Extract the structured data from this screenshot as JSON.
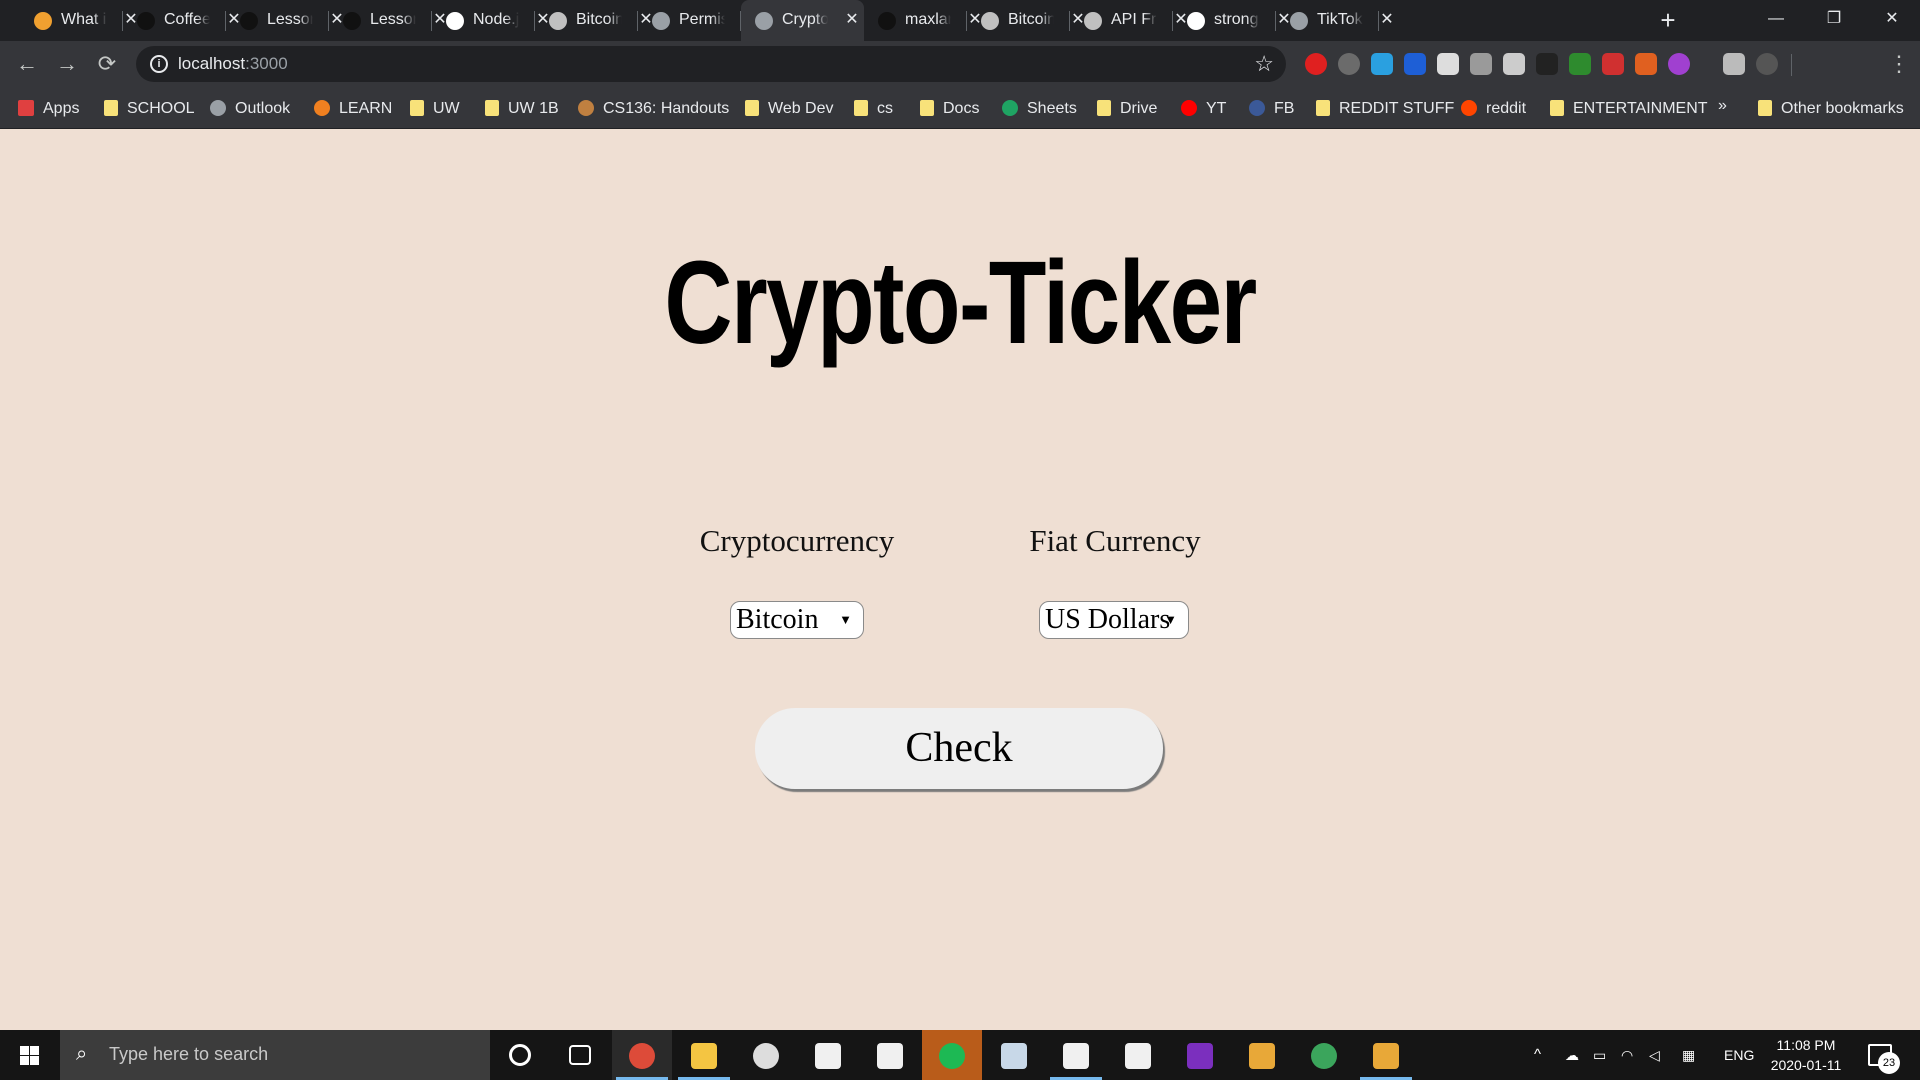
{
  "browser": {
    "tabs": [
      {
        "title": "What is",
        "favicon": "coffee-icon",
        "color": "#f0a030"
      },
      {
        "title": "Coffee",
        "favicon": "github-icon",
        "color": "#111111"
      },
      {
        "title": "Lesson",
        "favicon": "github-icon",
        "color": "#111111"
      },
      {
        "title": "Lesson",
        "favicon": "github-icon",
        "color": "#111111"
      },
      {
        "title": "Node.js",
        "favicon": "nodejs-icon",
        "color": "#ffffff"
      },
      {
        "title": "Bitcoin",
        "favicon": "bitcoin-icon",
        "color": "#c0c0c0"
      },
      {
        "title": "Permis",
        "favicon": "globe-icon",
        "color": "#9aa0a6"
      },
      {
        "title": "Crypto",
        "favicon": "globe-icon",
        "color": "#9aa0a6",
        "active": true
      },
      {
        "title": "maxlan",
        "favicon": "github-icon",
        "color": "#111111"
      },
      {
        "title": "Bitcoin",
        "favicon": "bitcoin-icon",
        "color": "#c0c0c0"
      },
      {
        "title": "API Fre",
        "favicon": "bitcoin-icon",
        "color": "#c0c0c0"
      },
      {
        "title": "strong",
        "favicon": "google-icon",
        "color": "#ffffff"
      },
      {
        "title": "TikTok",
        "favicon": "globe-icon",
        "color": "#9aa0a6"
      }
    ],
    "tab_close_glyph": "✕",
    "new_tab_glyph": "+",
    "window_controls": {
      "minimize": "—",
      "restore": "❐",
      "close": "✕"
    },
    "nav": {
      "back": "←",
      "forward": "→",
      "reload": "⟳"
    },
    "address": {
      "host": "localhost",
      "port": ":3000",
      "info_glyph": "i",
      "star_glyph": "☆"
    },
    "extensions": [
      {
        "name": "adblock-icon",
        "color": "#e02020"
      },
      {
        "name": "extension-gray-icon",
        "color": "#6b6b6b"
      },
      {
        "name": "window-icon",
        "color": "#2aa0e0"
      },
      {
        "name": "malwarebytes-icon",
        "color": "#1e5fd6"
      },
      {
        "name": "fonts-icon",
        "color": "#dddddd"
      },
      {
        "name": "lamp-icon",
        "color": "#9a9a9a"
      },
      {
        "name": "pen-icon",
        "color": "#cccccc"
      },
      {
        "name": "magnifier-icon",
        "color": "#222222"
      },
      {
        "name": "tree-icon",
        "color": "#2e8b2e"
      },
      {
        "name": "m-icon",
        "color": "#d03030"
      },
      {
        "name": "speaker-icon",
        "color": "#e06020"
      },
      {
        "name": "headphones-icon",
        "color": "#a040d0"
      },
      {
        "name": "media-icon",
        "color": "#bbbbbb"
      },
      {
        "name": "profile-avatar-icon",
        "color": "#555555"
      }
    ],
    "menu_glyph": "⋮",
    "bookmarks": [
      {
        "label": "Apps",
        "icon": "apps-grid-icon",
        "color": "#e04040"
      },
      {
        "label": "SCHOOL",
        "icon": "folder-icon",
        "color": "#f8e27a"
      },
      {
        "label": "Outlook",
        "icon": "globe-icon",
        "color": "#9aa0a6"
      },
      {
        "label": "LEARN",
        "icon": "learn-icon",
        "color": "#f08020"
      },
      {
        "label": "UW",
        "icon": "folder-icon",
        "color": "#f8e27a"
      },
      {
        "label": "UW 1B",
        "icon": "folder-icon",
        "color": "#f8e27a"
      },
      {
        "label": "CS136: Handouts",
        "icon": "shield-icon",
        "color": "#c08040"
      },
      {
        "label": "Web Dev",
        "icon": "folder-icon",
        "color": "#f8e27a"
      },
      {
        "label": "cs",
        "icon": "folder-icon",
        "color": "#f8e27a"
      },
      {
        "label": "Docs",
        "icon": "folder-icon",
        "color": "#f8e27a"
      },
      {
        "label": "Sheets",
        "icon": "sheets-icon",
        "color": "#1fa463"
      },
      {
        "label": "Drive",
        "icon": "folder-icon",
        "color": "#f8e27a"
      },
      {
        "label": "YT",
        "icon": "youtube-icon",
        "color": "#ff0000"
      },
      {
        "label": "FB",
        "icon": "facebook-icon",
        "color": "#3b5998"
      },
      {
        "label": "REDDIT STUFF",
        "icon": "folder-icon",
        "color": "#f8e27a"
      },
      {
        "label": "reddit",
        "icon": "reddit-icon",
        "color": "#ff4500"
      },
      {
        "label": "ENTERTAINMENT",
        "icon": "folder-icon",
        "color": "#f8e27a"
      }
    ],
    "bookmarks_overflow": "»",
    "other_bookmarks": "Other bookmarks"
  },
  "page": {
    "title": "Crypto-Ticker",
    "crypto_label": "Cryptocurrency",
    "crypto_selected": "Bitcoin",
    "fiat_label": "Fiat Currency",
    "fiat_selected": "US Dollars",
    "select_arrow": "▼",
    "check_button": "Check",
    "background": "#efdfd3"
  },
  "taskbar": {
    "search_placeholder": "Type here to search",
    "apps": [
      {
        "name": "cortana-icon",
        "color": "#151515"
      },
      {
        "name": "task-view-icon",
        "color": "#151515"
      },
      {
        "name": "chrome-icon",
        "color": "#dd4b39"
      },
      {
        "name": "file-explorer-icon",
        "color": "#f4c542"
      },
      {
        "name": "dell-icon",
        "color": "#dddddd"
      },
      {
        "name": "store-icon",
        "color": "#f0f0f0"
      },
      {
        "name": "mail-icon",
        "color": "#f0f0f0"
      },
      {
        "name": "spotify-icon",
        "color": "#1db954"
      },
      {
        "name": "photos-icon",
        "color": "#c8d8e8"
      },
      {
        "name": "settings-icon",
        "color": "#f0f0f0"
      },
      {
        "name": "security-icon",
        "color": "#f0f0f0"
      },
      {
        "name": "onenote-icon",
        "color": "#7b2fbe"
      },
      {
        "name": "git-icon",
        "color": "#e8a838"
      },
      {
        "name": "atom-icon",
        "color": "#3ba55c"
      },
      {
        "name": "git-gui-icon",
        "color": "#e8a838"
      }
    ],
    "tray": {
      "chevron": "^",
      "language": "ENG"
    },
    "time": "11:08 PM",
    "date": "2020-01-11",
    "notifications": "23"
  }
}
